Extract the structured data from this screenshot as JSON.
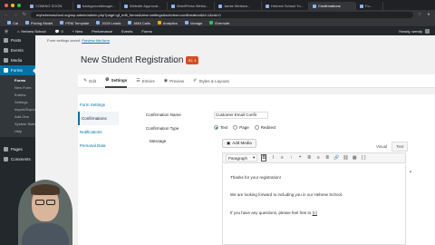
{
  "browser": {
    "tabs": [
      {
        "label": "COMING SOON"
      },
      {
        "label": "backgroundImage/..."
      },
      {
        "label": "Website Approval..."
      },
      {
        "label": "WordPress Websi..."
      },
      {
        "label": "Jamie Weissm..."
      },
      {
        "label": "Hebrew School Yo..."
      },
      {
        "label": "Confirmations"
      },
      {
        "label": "Fo..."
      }
    ],
    "url": "myhebrewschool.org/wp-admin/admin.php?page=gf_edit_forms&view=settings&subview=confirmation&id=1&cid=0",
    "bookmarks": [
      "Cal",
      "Pricing Model",
      "PRM Template",
      "2019 Leads",
      "AMA Calls",
      "Analytics",
      "Vonage",
      "Evernote"
    ]
  },
  "adminbar": {
    "site": "Hebrew School",
    "comments": "0",
    "new": "+ New",
    "performance": "Performance",
    "events": "Events",
    "forms": "Forms",
    "howdy": "Howdy, wendy"
  },
  "sidebar": {
    "items": [
      {
        "label": "Posts"
      },
      {
        "label": "Events"
      },
      {
        "label": "Media"
      },
      {
        "label": "Forms"
      },
      {
        "label": "Pages"
      },
      {
        "label": "Comments"
      }
    ],
    "forms_sub": [
      "Forms",
      "New Form",
      "Entries",
      "Settings",
      "Import/Export",
      "Add-Ons",
      "System Status",
      "Help"
    ]
  },
  "notice": {
    "text": "Form settings saved.",
    "link": "Preview this form"
  },
  "page": {
    "title": "New Student Registration",
    "id_badge": "ID: 1",
    "chevron": "⌄"
  },
  "formnav": {
    "edit": "Edit",
    "settings": "Settings",
    "entries": "Entries",
    "preview": "Preview",
    "styles": "Styles & Layouts"
  },
  "subnav": [
    "Form Settings",
    "Confirmations",
    "Notifications",
    "Personal Data"
  ],
  "confirmation": {
    "name_label": "Confirmation Name",
    "name_value": "Customer Email Confir",
    "type_label": "Confirmation Type",
    "types": [
      "Text",
      "Page",
      "Redirect"
    ],
    "message_label": "Message",
    "add_media": "Add Media",
    "visual": "Visual",
    "text_tab": "Text",
    "paragraph": "Paragraph",
    "tooltip": "Bold (⌘B)",
    "lines": [
      "Thanks for your registration!",
      "We are looking forward to including you in our Hebrew School.",
      "If you have any questions, please feel free to"
    ],
    "tail": "{c}"
  }
}
